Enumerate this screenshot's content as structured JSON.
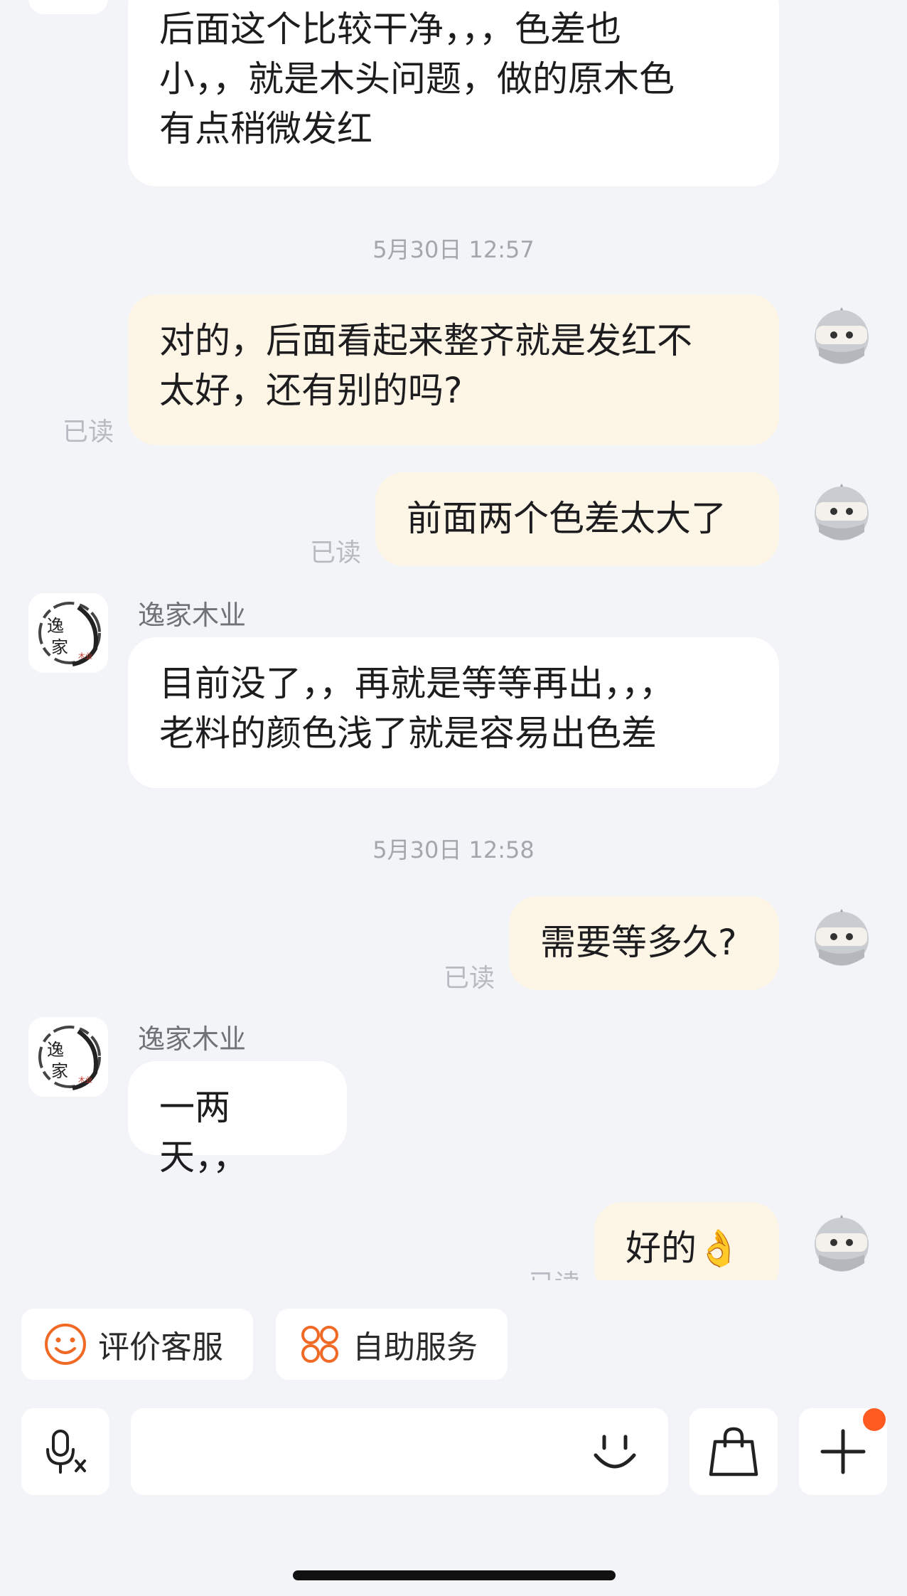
{
  "colors": {
    "background": "#f2f4f7",
    "bubble_incoming": "#ffffff",
    "bubble_outgoing": "#fdf5e6",
    "accent_orange": "#f06a26",
    "badge": "#ff5a1f"
  },
  "messages": {
    "m0": {
      "line1": "后面这个比较干净，，，色差也",
      "line2": "小，，就是木头问题，做的原木色",
      "line3": "有点稍微发红"
    },
    "ts1": "5月30日 12:57",
    "m1": {
      "line1": "对的，后面看起来整齐就是发红不",
      "line2": "太好，还有别的吗?",
      "status": "已读"
    },
    "m2": {
      "text": "前面两个色差太大了",
      "status": "已读"
    },
    "m3": {
      "sender": "逸家木业",
      "line1": "目前没了，，再就是等等再出，，，",
      "line2": "老料的颜色浅了就是容易出色差"
    },
    "ts2": "5月30日 12:58",
    "m4": {
      "text": "需要等多久?",
      "status": "已读"
    },
    "m5": {
      "sender": "逸家木业",
      "text": "一两天，，"
    },
    "m6": {
      "text": "好的👌",
      "status": "已读"
    }
  },
  "shop_avatar": {
    "char1": "逸",
    "char2": "家",
    "seal": "木业"
  },
  "quick_actions": {
    "rate": "评价客服",
    "self_service": "自助服务"
  },
  "toolbar": {
    "voice_icon": "voice-to-text-icon",
    "emoji_icon": "emoji-icon",
    "bag_icon": "shopping-bag-icon",
    "plus_icon": "plus-icon",
    "input_placeholder": ""
  }
}
